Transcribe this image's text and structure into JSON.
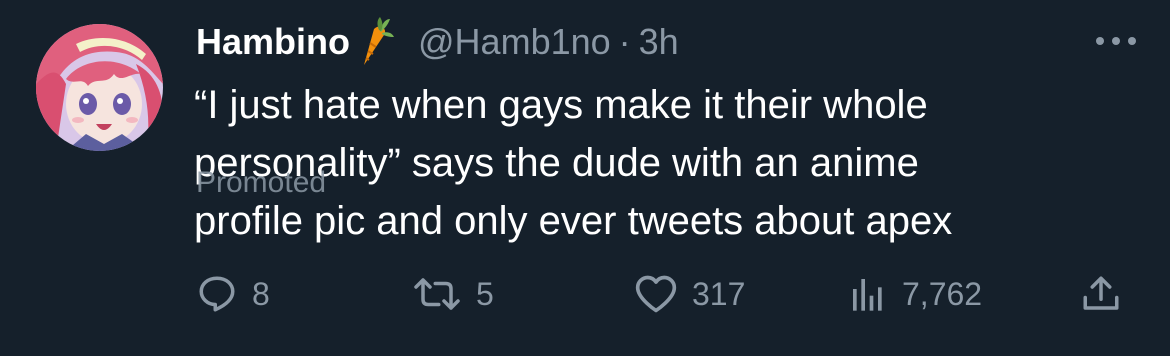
{
  "tweet": {
    "display_name": "Hambino",
    "handle": "@Hamb1no",
    "separator": "·",
    "time": "3h",
    "body_lines": [
      "“I just hate when gays make it their whole",
      "personality” says the dude with an anime",
      "profile pic and only ever tweets about apex"
    ],
    "promoted_label": "Promoted"
  },
  "actions": {
    "replies": "8",
    "retweets": "5",
    "likes": "317",
    "views": "7,762"
  },
  "icons": {
    "verified_emoji": "carrot-icon",
    "more": "more-dots-icon",
    "reply": "reply-icon",
    "retweet": "retweet-icon",
    "like": "heart-icon",
    "views": "views-icon",
    "share": "share-icon"
  },
  "colors": {
    "background": "#15202b",
    "text_primary": "#ffffff",
    "text_secondary": "#8b98a5",
    "carrot_orange": "#f4900c",
    "carrot_green": "#77b255"
  }
}
